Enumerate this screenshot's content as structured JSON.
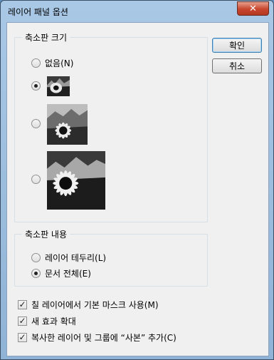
{
  "window": {
    "title": "레이어 패널 옵션",
    "close_label": "✕"
  },
  "buttons": {
    "ok": "확인",
    "cancel": "취소"
  },
  "thumbnail_size": {
    "group_label": "축소판 크기",
    "options": [
      {
        "label": "없음(N)",
        "checked": false
      },
      {
        "label": "",
        "checked": true
      },
      {
        "label": "",
        "checked": false
      },
      {
        "label": "",
        "checked": false
      }
    ]
  },
  "thumbnail_contents": {
    "group_label": "축소판 내용",
    "options": [
      {
        "label": "레이어 테두리(L)",
        "checked": false
      },
      {
        "label": "문서 전체(E)",
        "checked": true
      }
    ]
  },
  "checkboxes": [
    {
      "label": "칠 레이어에서 기본 마스크 사용(M)",
      "checked": true
    },
    {
      "label": "새 효과 확대",
      "checked": true
    },
    {
      "label": "복사한 레이어 및 그룹에 “사본” 추가(C)",
      "checked": true
    }
  ]
}
